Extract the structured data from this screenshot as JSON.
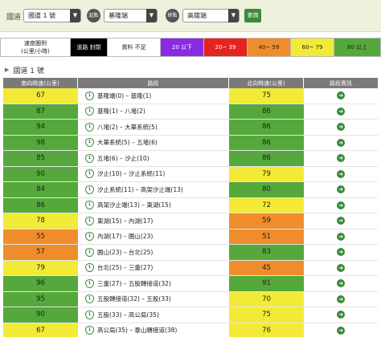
{
  "topbar": {
    "label": "國道",
    "road": "國道 1 號",
    "start_badge": "起點",
    "start": "基隆端",
    "end_badge": "終點",
    "end": "高雄端",
    "query": "查詢"
  },
  "legend": [
    {
      "text": "速度圖例\n(公里/小時)",
      "bg": "#ffffff",
      "fg": "#222222"
    },
    {
      "text": "道路 封閉",
      "bg": "#000000",
      "fg": "#ffffff"
    },
    {
      "text": "資料 不足",
      "bg": "#ffffff",
      "fg": "#222222"
    },
    {
      "text": "20 以下",
      "bg": "#8a2be2",
      "fg": "#ffffff"
    },
    {
      "text": "20~ 39",
      "bg": "#e52420",
      "fg": "#ffffff"
    },
    {
      "text": "40~ 59",
      "bg": "#ef8d2c",
      "fg": "#222222"
    },
    {
      "text": "60~ 79",
      "bg": "#f2ea37",
      "fg": "#222222"
    },
    {
      "text": "80 以上",
      "bg": "#55a83b",
      "fg": "#222222"
    }
  ],
  "section_title": "國道 1 號",
  "table": {
    "headers": [
      "南向時速(公里)",
      "路段",
      "北向時速(公里)",
      "路段資訊"
    ],
    "rows": [
      {
        "s": "67",
        "seg": "基隆端(0) – 基隆(1)",
        "n": "75",
        "sc": "#f2ea37",
        "nc": "#f2ea37"
      },
      {
        "s": "87",
        "seg": "基隆(1) – 八堵(2)",
        "n": "86",
        "sc": "#55a83b",
        "nc": "#55a83b"
      },
      {
        "s": "94",
        "seg": "八堵(2) – 大華系統(5)",
        "n": "86",
        "sc": "#55a83b",
        "nc": "#55a83b"
      },
      {
        "s": "98",
        "seg": "大華系統(5) – 五堵(6)",
        "n": "86",
        "sc": "#55a83b",
        "nc": "#55a83b"
      },
      {
        "s": "85",
        "seg": "五堵(6) – 汐止(10)",
        "n": "86",
        "sc": "#55a83b",
        "nc": "#55a83b"
      },
      {
        "s": "90",
        "seg": "汐止(10) – 汐止系統(11)",
        "n": "79",
        "sc": "#55a83b",
        "nc": "#f2ea37"
      },
      {
        "s": "84",
        "seg": "汐止系統(11) – 高架汐止端(13)",
        "n": "80",
        "sc": "#55a83b",
        "nc": "#55a83b"
      },
      {
        "s": "86",
        "seg": "高架汐止端(13) – 東湖(15)",
        "n": "72",
        "sc": "#55a83b",
        "nc": "#f2ea37"
      },
      {
        "s": "78",
        "seg": "東湖(15) – 內湖(17)",
        "n": "59",
        "sc": "#f2ea37",
        "nc": "#ef8d2c"
      },
      {
        "s": "55",
        "seg": "內湖(17) – 圓山(23)",
        "n": "51",
        "sc": "#ef8d2c",
        "nc": "#ef8d2c"
      },
      {
        "s": "57",
        "seg": "圓山(23) – 台北(25)",
        "n": "83",
        "sc": "#ef8d2c",
        "nc": "#55a83b"
      },
      {
        "s": "79",
        "seg": "台北(25) – 三重(27)",
        "n": "45",
        "sc": "#f2ea37",
        "nc": "#ef8d2c"
      },
      {
        "s": "96",
        "seg": "三重(27) – 五股轉接道(32)",
        "n": "91",
        "sc": "#55a83b",
        "nc": "#55a83b"
      },
      {
        "s": "95",
        "seg": "五股轉接道(32) – 五股(33)",
        "n": "70",
        "sc": "#55a83b",
        "nc": "#f2ea37"
      },
      {
        "s": "90",
        "seg": "五股(33) – 高公局(35)",
        "n": "75",
        "sc": "#55a83b",
        "nc": "#f2ea37"
      },
      {
        "s": "67",
        "seg": "高公局(35) – 泰山轉接道(38)",
        "n": "76",
        "sc": "#f2ea37",
        "nc": "#f2ea37"
      }
    ]
  },
  "icons": {
    "highway": "highway-shield-icon",
    "info": "arrow-right-circle-icon"
  }
}
